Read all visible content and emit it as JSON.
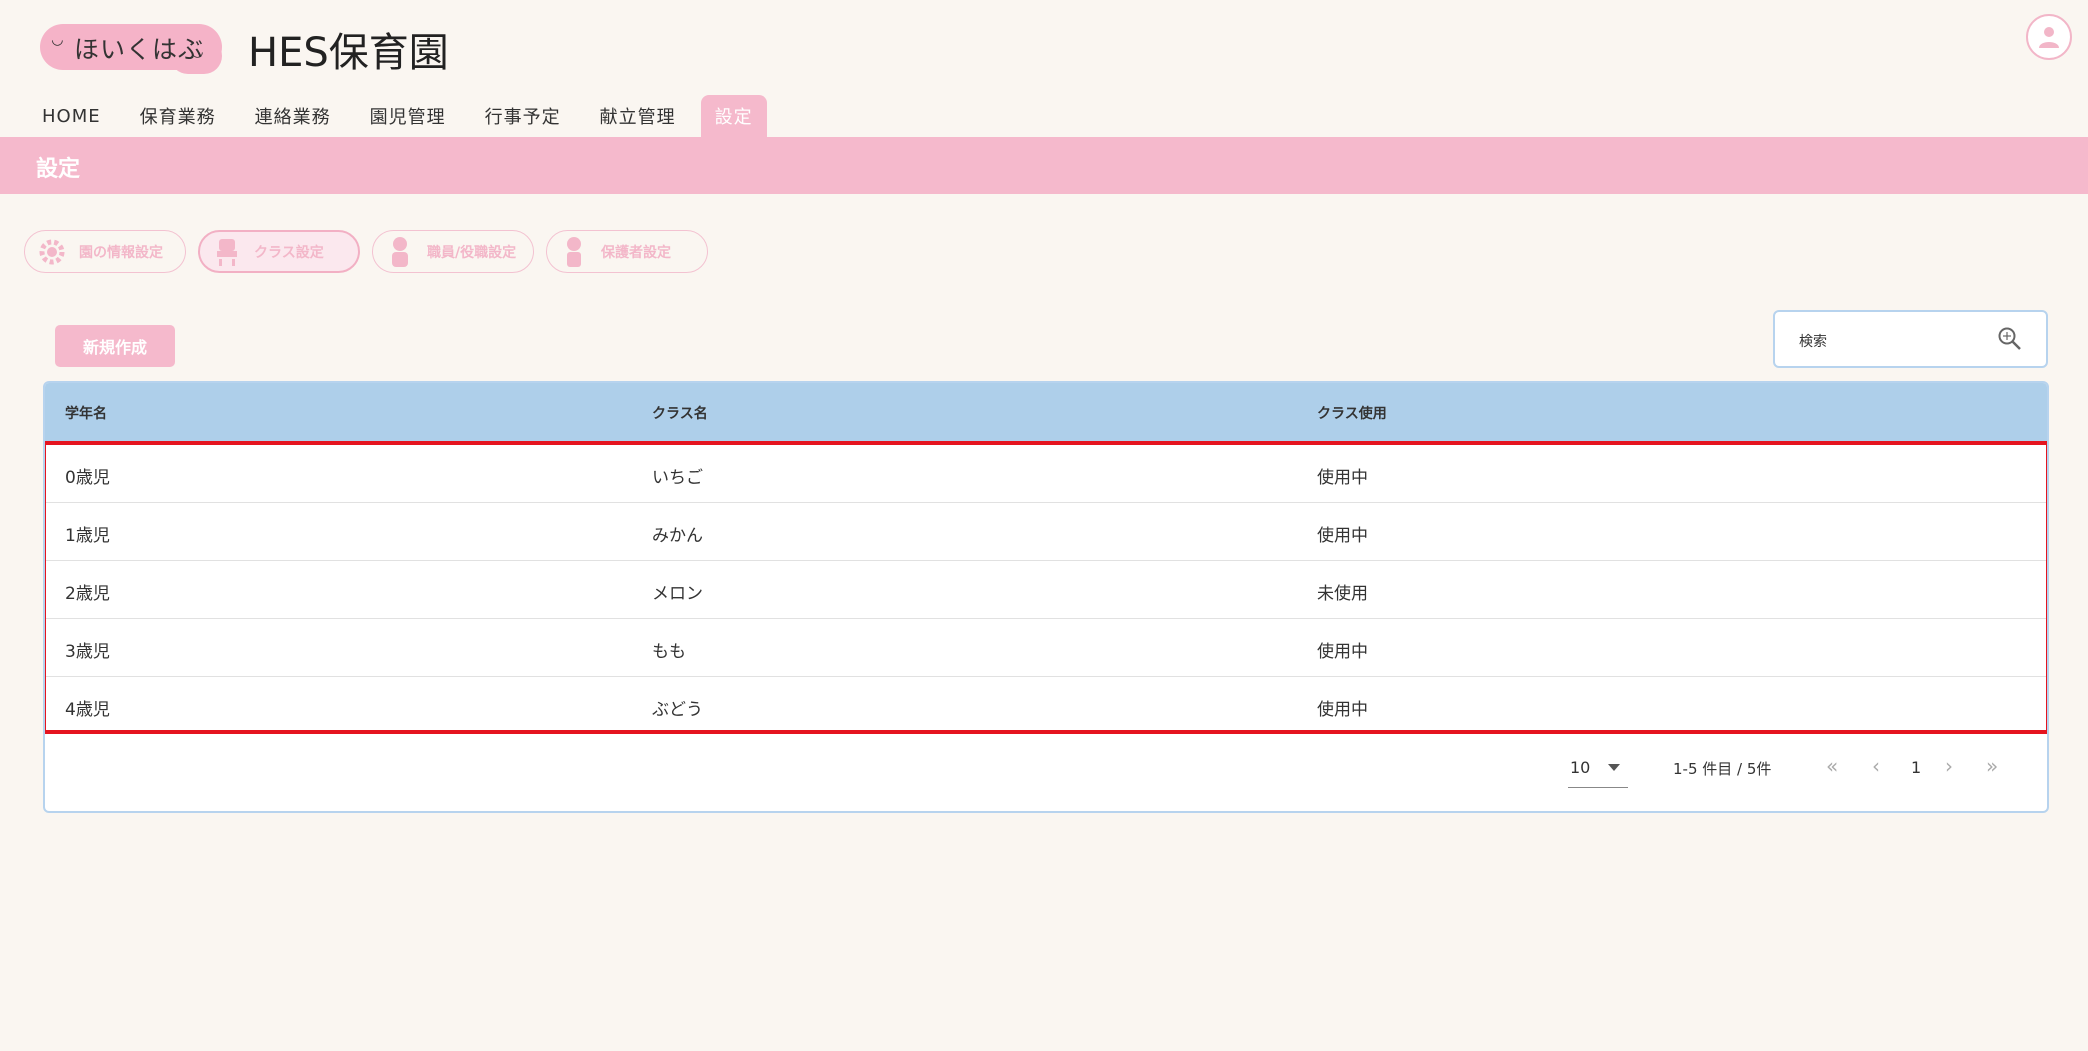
{
  "header": {
    "logo_text": "ほいくはぶ",
    "site_title": "HES保育園"
  },
  "nav": {
    "items": [
      {
        "label": "HOME"
      },
      {
        "label": "保育業務"
      },
      {
        "label": "連絡業務"
      },
      {
        "label": "園児管理"
      },
      {
        "label": "行事予定"
      },
      {
        "label": "献立管理"
      },
      {
        "label": "設定"
      }
    ],
    "active": "設定"
  },
  "page_title": "設定",
  "settings_tabs": [
    {
      "label": "園の情報設定",
      "icon": "gear-icon"
    },
    {
      "label": "クラス設定",
      "icon": "class-icon"
    },
    {
      "label": "職員/役職設定",
      "icon": "staff-icon"
    },
    {
      "label": "保護者設定",
      "icon": "guardian-icon"
    }
  ],
  "new_button_label": "新規作成",
  "search": {
    "placeholder": "検索"
  },
  "table": {
    "columns": [
      "学年名",
      "クラス名",
      "クラス使用"
    ],
    "rows": [
      [
        "0歳児",
        "いちご",
        "使用中"
      ],
      [
        "1歳児",
        "みかん",
        "使用中"
      ],
      [
        "2歳児",
        "メロン",
        "未使用"
      ],
      [
        "3歳児",
        "もも",
        "使用中"
      ],
      [
        "4歳児",
        "ぶどう",
        "使用中"
      ]
    ]
  },
  "pagination": {
    "per_page": "10",
    "range": "1-5 件目 / 5件",
    "page": "1"
  },
  "colors": {
    "accent_pink": "#f5b9cc",
    "table_header_blue": "#aecfea",
    "highlight_red": "#e5141f",
    "background": "#faf6f1"
  }
}
